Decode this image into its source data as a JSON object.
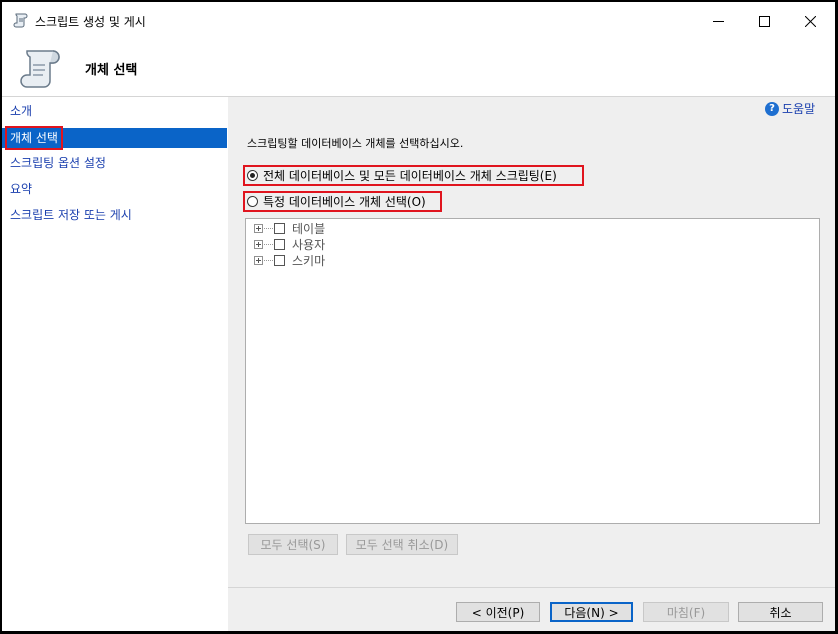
{
  "window": {
    "title": "스크립트 생성 및 게시"
  },
  "header": {
    "title": "개체 선택"
  },
  "sidebar": {
    "items": [
      {
        "label": "소개"
      },
      {
        "label": "개체 선택"
      },
      {
        "label": "스크립팅 옵션 설정"
      },
      {
        "label": "요약"
      },
      {
        "label": "스크립트 저장 또는 게시"
      }
    ]
  },
  "content": {
    "help_label": "도움말",
    "instruction": "스크립팅할 데이터베이스 개체를 선택하십시오.",
    "options": [
      {
        "label": "전체 데이터베이스 및 모든 데이터베이스 개체 스크립팅(E)",
        "checked": true
      },
      {
        "label": "특정 데이터베이스 개체 선택(O)",
        "checked": false
      }
    ],
    "tree": [
      {
        "label": "테이블"
      },
      {
        "label": "사용자"
      },
      {
        "label": "스키마"
      }
    ],
    "select_all_label": "모두 선택(S)",
    "deselect_all_label": "모두 선택 취소(D)"
  },
  "footer": {
    "prev_label": "< 이전(P)",
    "next_label": "다음(N) >",
    "finish_label": "마침(F)",
    "cancel_label": "취소"
  },
  "colors": {
    "accent": "#0a64c8",
    "highlight_box": "#e0141e",
    "link": "#1a3fae"
  }
}
